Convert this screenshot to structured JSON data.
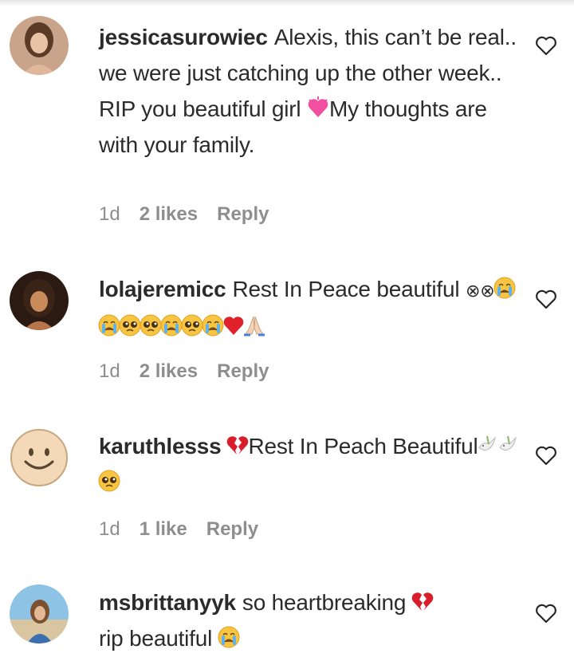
{
  "comments": [
    {
      "username": "jessicasurowiec",
      "text_parts": [
        "Alexis, this can’t be real.. we were just catching up the other week.. RIP you beautiful girl ",
        "My thoughts are with your family."
      ],
      "emoji_icons": [
        "pink-heart-icon"
      ],
      "time": "1d",
      "likes": "2 likes",
      "reply": "Reply"
    },
    {
      "username": "lolajeremicc",
      "text_parts": [
        "Rest In Peace beautiful ",
        "⊗⊗"
      ],
      "emoji_icons": [
        "crying-face-icon",
        "crying-face-icon",
        "pleading-face-icon",
        "pleading-face-icon",
        "crying-face-icon",
        "pleading-face-icon",
        "crying-face-icon",
        "red-heart-icon",
        "folded-hands-icon"
      ],
      "time": "1d",
      "likes": "2 likes",
      "reply": "Reply"
    },
    {
      "username": "karuthlesss",
      "text_parts": [
        "Rest In Peach Beautiful"
      ],
      "emoji_icons": [
        "broken-heart-icon",
        "dove-icon",
        "dove-icon",
        "pleading-face-icon"
      ],
      "time": "1d",
      "likes": "1 like",
      "reply": "Reply"
    },
    {
      "username": "msbrittanyyk",
      "text_parts": [
        "so heartbreaking ",
        "rip beautiful"
      ],
      "emoji_icons": [
        "broken-heart-icon",
        "crying-face-icon"
      ],
      "time": "",
      "likes": "",
      "reply": ""
    }
  ],
  "colors": {
    "text": "#262626",
    "meta": "#8e8e8e",
    "heart_outline": "#262626",
    "emoji_yellow": "#f7c542",
    "red_heart": "#e0202a",
    "pink_heart": "#f24fa0"
  }
}
